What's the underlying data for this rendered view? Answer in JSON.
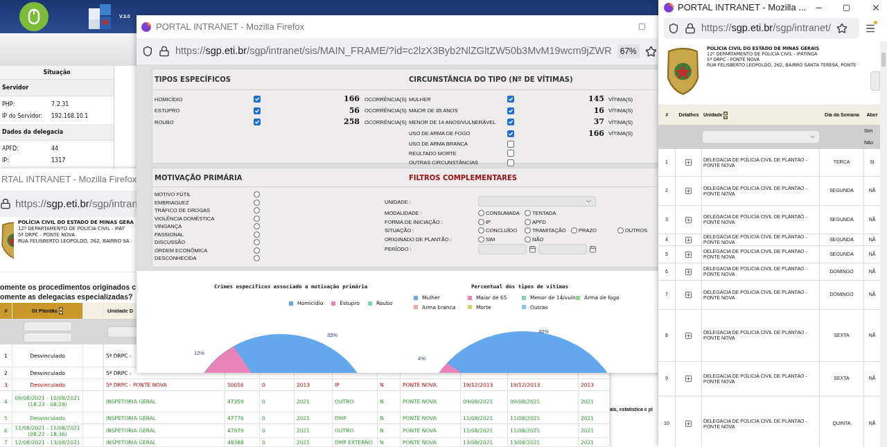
{
  "background_app": {
    "version": "V.3.0",
    "status": {
      "header": "Situação",
      "sections": [
        {
          "title": "Servidor",
          "rows": [
            {
              "label": "PHP:",
              "value": "7.2.31"
            },
            {
              "label": "IP do Servidor:",
              "value": "192.168.10.1"
            }
          ]
        },
        {
          "title": "Dados da delegacia",
          "rows": [
            {
              "label": "APFD:",
              "value": "44"
            },
            {
              "label": "IP:",
              "value": "1317"
            }
          ]
        }
      ]
    },
    "note": "ais, estatística e pl"
  },
  "left_window": {
    "title": "RTAL INTRANET - Mozilla Firefox",
    "url": {
      "scheme": "https://",
      "host": "sgp.eti.br",
      "path": "/sgp/intran"
    },
    "agency": [
      "POLÍCIA CIVIL DO ESTADO DE MINAS GERA",
      "12º DEPARTAMENTO DE POLICIA CIVIL - IPAT",
      "5ª DRPC - PONTE NOVA",
      "RUA FELISBERTO LEOPOLDO, 262, BAIRRO SA"
    ],
    "question": [
      "omente os procedimentos originados c",
      "omente as delegacias especializadas?"
    ],
    "table": {
      "columns": [
        {
          "label": "#",
          "sortable": false
        },
        {
          "label": "Dt Plantão",
          "sortable": true
        },
        {
          "label": "Unidade D",
          "sortable": false
        }
      ],
      "rows": [
        {
          "kind": "normal",
          "cells": [
            "1",
            "Desvinculado",
            "5ª DRPC -"
          ]
        },
        {
          "kind": "normal",
          "cells": [
            "2",
            "Desvinculado",
            "5ª DRPC -"
          ]
        },
        {
          "kind": "alert",
          "cells": [
            "3",
            "Desvinculado",
            "5ª DRPC - PONTE NOVA",
            "50056",
            "0",
            "2013",
            "IP",
            "N",
            "PONTE NOVA",
            "19/12/2013",
            "19/12/2013",
            "2013"
          ]
        },
        {
          "kind": "ok",
          "cells": [
            "4",
            "09/08/2021 - 10/08/2021 (18:23 - 08:28)",
            "INSPETORIA GERAL",
            "47359",
            "0",
            "2021",
            "OUTRO",
            "N",
            "PONTE NOVA",
            "09/08/2021",
            "09/08/2021",
            "2021"
          ]
        },
        {
          "kind": "ok",
          "cells": [
            "5",
            "Desvinculado",
            "INSPETORIA GERAL",
            "47776",
            "0",
            "2021",
            "DMP",
            "N",
            "PONTE NOVA",
            "11/08/2021",
            "11/08/2021",
            "2021"
          ]
        },
        {
          "kind": "ok",
          "cells": [
            "6",
            "11/08/2021 - 11/08/2021 (08:22 - 18:36)",
            "INSPETORIA GERAL",
            "47979",
            "0",
            "2021",
            "OUTRO",
            "N",
            "PONTE NOVA",
            "11/08/2021",
            "11/08/2021",
            "2021"
          ]
        },
        {
          "kind": "ok",
          "cells": [
            "7",
            "12/08/2021 - 13/08/2021",
            "INSPETORIA GERAL",
            "48388",
            "0",
            "2021",
            "DMP EXTERNO",
            "N",
            "PONTE NOVA",
            "13/08/2021",
            "13/08/2021",
            "2021"
          ]
        }
      ]
    }
  },
  "main_window": {
    "title": "PORTAL INTRANET - Mozilla Firefox",
    "url": {
      "scheme": "https://",
      "host": "sgp.eti.br",
      "path": "/sgp/intranet/sis/MAIN_FRAME/?id=c2lzX3Byb2NlZGltZW50b3MvM19wcm9jZWR"
    },
    "zoom": "67%",
    "types": {
      "title": "TIPOS ESPECÍFICOS",
      "items": [
        {
          "label": "HOMICÍDIO",
          "checked": true,
          "count": "166",
          "unit": "OCORRÊNCIA(S)"
        },
        {
          "label": "ESTUPRO",
          "checked": true,
          "count": "56",
          "unit": "OCORRÊNCIA(S)"
        },
        {
          "label": "ROUBO",
          "checked": true,
          "count": "258",
          "unit": "OCORRÊNCIA(S)"
        }
      ]
    },
    "circumstances": {
      "title": "CIRCUNSTÂNCIA DO TIPO (Nº DE VÍTIMAS)",
      "items": [
        {
          "label": "MULHER",
          "checked": true,
          "count": "145",
          "unit": "VÍTIMA(S)"
        },
        {
          "label": "MAIOR DE 65 ANOS",
          "checked": true,
          "count": "16",
          "unit": "VÍTIMA(S)"
        },
        {
          "label": "MENOR DE 14 ANOS/VULNERÁVEL",
          "checked": true,
          "count": "37",
          "unit": "VÍTIMA(S)"
        },
        {
          "label": "USO DE ARMA DE FOGO",
          "checked": true,
          "count": "166",
          "unit": "VÍTIMA(S)"
        },
        {
          "label": "USO DE ARMA BRANCA",
          "checked": false
        },
        {
          "label": "REULTADO MORTE",
          "checked": false
        },
        {
          "label": "OUTRAS CIRCUNSTÂNCIAS",
          "checked": false
        }
      ]
    },
    "motivation": {
      "title": "MOTIVAÇÃO PRIMÁRIA",
      "options": [
        {
          "label": "MOTIVO FÚTIL",
          "selected": false
        },
        {
          "label": "EMBRIAGUEZ",
          "selected": false
        },
        {
          "label": "TRÁFICO DE DROGAS",
          "selected": false
        },
        {
          "label": "VIOLÊNCIA DOMÉSTICA",
          "selected": false
        },
        {
          "label": "VINGANÇA",
          "selected": false
        },
        {
          "label": "PASSIONAL",
          "selected": false
        },
        {
          "label": "DISCUSSÃO",
          "selected": false
        },
        {
          "label": "ORDEM ECONÔMICA",
          "selected": false
        },
        {
          "label": "DESCONHECIDA",
          "selected": false
        }
      ]
    },
    "filters": {
      "title": "FILTROS COMPLEMENTARES",
      "fields": [
        {
          "kind": "select",
          "label": "UNIDADE :"
        },
        {
          "kind": "radio",
          "label": "MODALIDADE :",
          "options": [
            {
              "label": "CONSUMADA",
              "selected": false
            },
            {
              "label": "TENTADA",
              "selected": false
            }
          ]
        },
        {
          "kind": "radio",
          "label": "FORMA DE INICIAÇÃO :",
          "options": [
            {
              "label": "IP",
              "selected": false
            },
            {
              "label": "APFD",
              "selected": false
            }
          ]
        },
        {
          "kind": "radio",
          "label": "SITUAÇÃO :",
          "options": [
            {
              "label": "CONCLUÍDO",
              "selected": false
            },
            {
              "label": "TRAMITAÇÃO",
              "selected": false
            },
            {
              "label": "PRAZO",
              "selected": false
            },
            {
              "label": "OUTROS",
              "selected": false
            }
          ]
        },
        {
          "kind": "radio",
          "label": "ORIGINADO DE PLANTÃO :",
          "options": [
            {
              "label": "SIM",
              "selected": false
            },
            {
              "label": "NÃO",
              "selected": false
            }
          ]
        },
        {
          "kind": "period",
          "label": "PERÍODO :"
        }
      ]
    },
    "charts": [
      {
        "title": "Crimes específicos associado a motivação primária",
        "legend": [
          {
            "label": "Homicídio",
            "color": "#63a8ec"
          },
          {
            "label": "Estupro",
            "color": "#ea84b8"
          },
          {
            "label": "Roubo",
            "color": "#7dd8ae"
          }
        ],
        "labels": [
          "35%",
          "12%"
        ]
      },
      {
        "title": "Percentual dos tipos de vítimas",
        "legend": [
          {
            "label": "Mulher",
            "color": "#63a8ec"
          },
          {
            "label": "Maior de 65",
            "color": "#ea84b8"
          },
          {
            "label": "Menor de 14/vuln",
            "color": "#7dd8ae"
          },
          {
            "label": "Arma de fogo",
            "color": "#86d98a"
          },
          {
            "label": "Arma branca",
            "color": "#f2a5a5"
          },
          {
            "label": "Morte",
            "color": "#c9d46a"
          },
          {
            "label": "Outras",
            "color": "#86c8ea"
          }
        ],
        "labels": [
          "40%",
          "4%"
        ]
      }
    ]
  },
  "right_window": {
    "title": "PORTAL INTRANET - Mozilla ...",
    "url": {
      "scheme": "https://",
      "host": "sgp.eti.br",
      "path": "/sgp/intranet/"
    },
    "agency": [
      "POLÍCIA CIVIL DO ESTADO DE MINAS GERAIS",
      "12º DEPARTAMENTO DE POLICIA CIVIL - IPATINGA",
      "5ª DRPC - PONTE NOVA",
      "RUA FELISBERTO LEOPOLDO, 262, BAIRRO SANTA TERESA, PONTE"
    ],
    "table": {
      "columns": [
        {
          "label": "#",
          "sortable": false
        },
        {
          "label": "Detalhes",
          "sortable": false
        },
        {
          "label": "Unidade",
          "sortable": true
        },
        {
          "label": "Dia da Semana",
          "sortable": false
        },
        {
          "label": "Aber",
          "sortable": false
        }
      ],
      "filter_options": [
        "Sim",
        "Não"
      ],
      "rows": [
        {
          "number": "1",
          "unit": "DELEGACIA DE POLICIA CIVIL DE PLANTAO - PONTE NOVA",
          "day": "TERCA",
          "open": "SI"
        },
        {
          "number": "2",
          "unit": "DELEGACIA DE POLICIA CIVIL DE PLANTAO - PONTE NOVA",
          "day": "SEGUNDA",
          "open": "NÃ"
        },
        {
          "number": "3",
          "unit": "DELEGACIA DE POLICIA CIVIL DE PLANTAO - PONTE NOVA",
          "day": "SEGUNDA",
          "open": "NÃ"
        },
        {
          "number": "4",
          "unit": "DELEGACIA DE POLICIA CIVIL DE PLANTAO - PONTE NOVA",
          "day": "SEGUNDA",
          "open": "NÃ"
        },
        {
          "number": "5",
          "unit": "DELEGACIA DE POLICIA CIVIL DE PLANTAO - PONTE NOVA",
          "day": "SEGUNDA",
          "open": "NÃ"
        },
        {
          "number": "6",
          "unit": "DELEGACIA DE POLICIA CIVIL DE PLANTAO - PONTE NOVA",
          "day": "DOMINGO",
          "open": "NÃ"
        },
        {
          "number": "7",
          "unit": "DELEGACIA DE POLICIA CIVIL DE PLANTAO - PONTE NOVA",
          "day": "DOMINGO",
          "open": "NÃ"
        },
        {
          "number": "8",
          "unit": "DELEGACIA DE POLICIA CIVIL DE PLANTAO - PONTE NOVA",
          "day": "SEXTA",
          "open": "NÃ"
        },
        {
          "number": "9",
          "unit": "DELEGACIA DE POLICIA CIVIL DE PLANTAO - PONTE NOVA",
          "day": "SEXTA",
          "open": "NÃ"
        },
        {
          "number": "10",
          "unit": "DELEGACIA DE POLICIA CIVIL DE PLANTAO - PONTE NOVA",
          "day": "QUINTA",
          "open": "NÃ"
        }
      ]
    }
  }
}
